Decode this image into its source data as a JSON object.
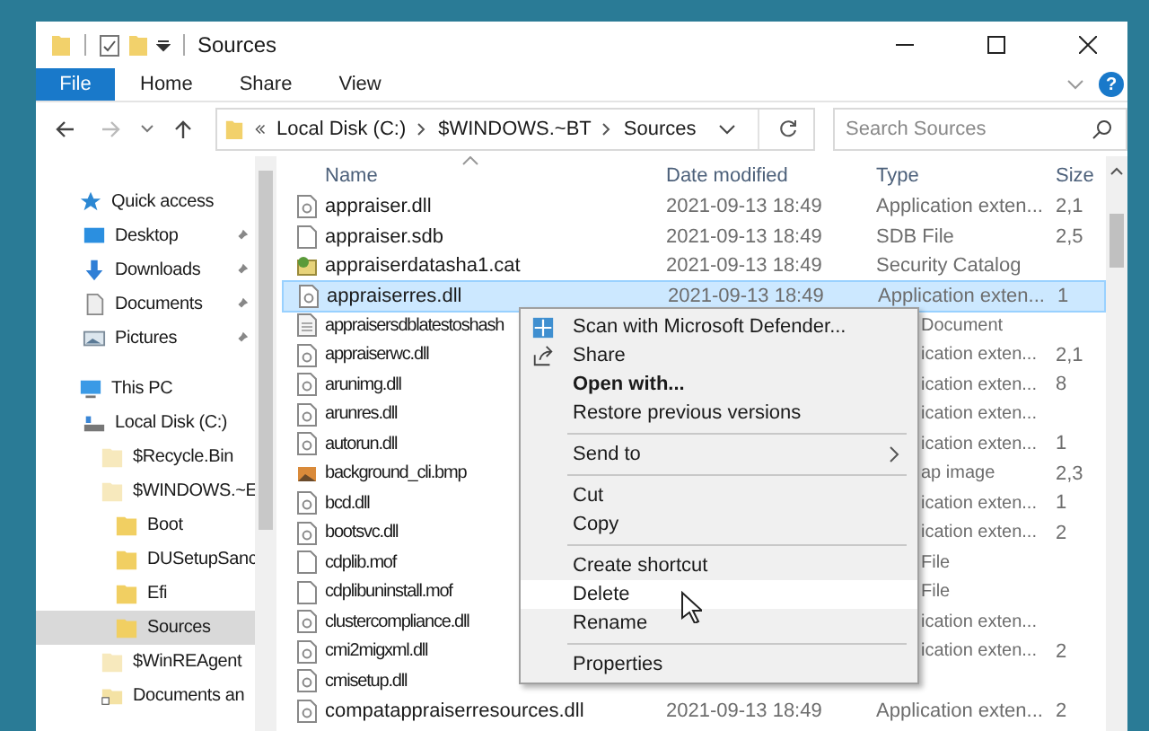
{
  "window": {
    "title": "Sources"
  },
  "ribbon": {
    "file_tab": "File",
    "tabs": [
      {
        "label": "Home",
        "selected": false
      },
      {
        "label": "Share",
        "selected": false
      },
      {
        "label": "View",
        "selected": false
      }
    ],
    "help": "?"
  },
  "address": {
    "path": [
      "Local Disk (C:)",
      "$WINDOWS.~BT",
      "Sources"
    ]
  },
  "search": {
    "placeholder": "Search Sources"
  },
  "sidebar": {
    "items": [
      {
        "label": "Quick access",
        "kind": "star",
        "selected": false,
        "children": [
          {
            "label": "Desktop",
            "kind": "desktop",
            "pinned": true,
            "selected": false
          },
          {
            "label": "Downloads",
            "kind": "download",
            "pinned": true,
            "selected": false
          },
          {
            "label": "Documents",
            "kind": "document",
            "pinned": true,
            "selected": false
          },
          {
            "label": "Pictures",
            "kind": "pictures",
            "pinned": true,
            "selected": false
          }
        ]
      },
      {
        "label": "This PC",
        "kind": "pc",
        "selected": false,
        "children": [
          {
            "label": "Local Disk (C:)",
            "kind": "drive",
            "selected": false,
            "children": [
              {
                "label": "$Recycle.Bin",
                "kind": "hidden",
                "selected": false
              },
              {
                "label": "$WINDOWS.~E",
                "kind": "hidden",
                "selected": false,
                "children": [
                  {
                    "label": "Boot",
                    "kind": "folder",
                    "selected": false
                  },
                  {
                    "label": "DUSetupSanc",
                    "kind": "folder",
                    "selected": false
                  },
                  {
                    "label": "Efi",
                    "kind": "folder",
                    "selected": false
                  },
                  {
                    "label": "Sources",
                    "kind": "folder",
                    "selected": true
                  }
                ]
              },
              {
                "label": "$WinREAgent",
                "kind": "hidden",
                "selected": false
              },
              {
                "label": "Documents an",
                "kind": "shortcut",
                "selected": false
              }
            ]
          }
        ]
      }
    ]
  },
  "table": {
    "columns": [
      "Name",
      "Date modified",
      "Type",
      "Size"
    ],
    "rows": [
      {
        "name": "appraiser.dll",
        "kind": "dll",
        "date": "2021-09-13 18:49",
        "type": "Application exten...",
        "size": "2,1",
        "selected": false,
        "covered": false
      },
      {
        "name": "appraiser.sdb",
        "kind": "file",
        "date": "2021-09-13 18:49",
        "type": "SDB File",
        "size": "2,5",
        "selected": false,
        "covered": false
      },
      {
        "name": "appraiserdatasha1.cat",
        "kind": "cat",
        "date": "2021-09-13 18:49",
        "type": "Security Catalog",
        "selected": false,
        "covered": false
      },
      {
        "name": "appraiserres.dll",
        "kind": "dll",
        "date": "2021-09-13 18:49",
        "type": "Application exten...",
        "size": "1",
        "selected": true,
        "covered": false
      },
      {
        "name": "appraisersdblatestoshash",
        "kind": "text",
        "type": "Document",
        "selected": false,
        "covered": true
      },
      {
        "name": "appraiserwc.dll",
        "kind": "dll",
        "type": "ication exten...",
        "size": "2,1",
        "selected": false,
        "covered": true
      },
      {
        "name": "arunimg.dll",
        "kind": "dll",
        "type": "ication exten...",
        "size": "8",
        "selected": false,
        "covered": true
      },
      {
        "name": "arunres.dll",
        "kind": "dll",
        "type": "ication exten...",
        "selected": false,
        "covered": true
      },
      {
        "name": "autorun.dll",
        "kind": "dll",
        "type": "ication exten...",
        "size": "1",
        "selected": false,
        "covered": true
      },
      {
        "name": "background_cli.bmp",
        "kind": "image",
        "type": "ap image",
        "size": "2,3",
        "selected": false,
        "covered": true
      },
      {
        "name": "bcd.dll",
        "kind": "dll",
        "type": "ication exten...",
        "size": "1",
        "selected": false,
        "covered": true
      },
      {
        "name": "bootsvc.dll",
        "kind": "dll",
        "type": "ication exten...",
        "size": "2",
        "selected": false,
        "covered": true
      },
      {
        "name": "cdplib.mof",
        "kind": "file",
        "type": "File",
        "selected": false,
        "covered": true
      },
      {
        "name": "cdplibuninstall.mof",
        "kind": "file",
        "type": "File",
        "selected": false,
        "covered": true
      },
      {
        "name": "clustercompliance.dll",
        "kind": "dll",
        "type": "ication exten...",
        "selected": false,
        "covered": true
      },
      {
        "name": "cmi2migxml.dll",
        "kind": "dll",
        "type": "ication exten...",
        "size": "2",
        "selected": false,
        "covered": true
      },
      {
        "name": "cmisetup.dll",
        "kind": "dll",
        "selected": false,
        "covered": true
      },
      {
        "name": "compatappraiserresources.dll",
        "kind": "dll",
        "date": "2021-09-13 18:49",
        "type": "Application exten...",
        "size": "2",
        "selected": false,
        "covered": false
      }
    ]
  },
  "context_menu": {
    "items": [
      {
        "kind": "scan",
        "label": "Scan with Microsoft Defender...",
        "emphasized": false,
        "highlighted": false
      },
      {
        "kind": "share",
        "label": "Share",
        "emphasized": false,
        "highlighted": false
      },
      {
        "kind": "item",
        "label": "Open with...",
        "emphasized": true,
        "highlighted": false
      },
      {
        "kind": "item",
        "label": "Restore previous versions",
        "emphasized": false,
        "highlighted": false
      },
      {
        "kind": "separator"
      },
      {
        "kind": "submenu",
        "label": "Send to",
        "emphasized": false,
        "highlighted": false
      },
      {
        "kind": "separator"
      },
      {
        "kind": "item",
        "label": "Cut",
        "emphasized": false,
        "highlighted": false
      },
      {
        "kind": "item",
        "label": "Copy",
        "emphasized": false,
        "highlighted": false
      },
      {
        "kind": "separator"
      },
      {
        "kind": "item",
        "label": "Create shortcut",
        "emphasized": false,
        "highlighted": false
      },
      {
        "kind": "item",
        "label": "Delete",
        "emphasized": false,
        "highlighted": true
      },
      {
        "kind": "item",
        "label": "Rename",
        "emphasized": false,
        "highlighted": false
      },
      {
        "kind": "separator"
      },
      {
        "kind": "item",
        "label": "Properties",
        "emphasized": false,
        "highlighted": false
      }
    ]
  }
}
